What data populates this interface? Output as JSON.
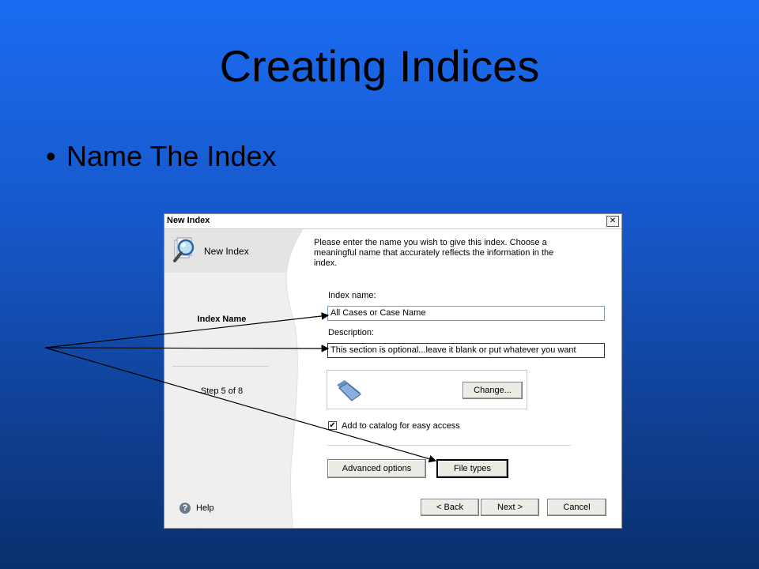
{
  "slide": {
    "title": "Creating Indices",
    "bullet": "Name The Index",
    "bullet_char": "•"
  },
  "dialog": {
    "title": "New Index",
    "close_glyph": "✕",
    "heading": "New Index",
    "step_name": "Index Name",
    "step_count": "Step 5 of 8",
    "help_label": "Help",
    "help_glyph": "?",
    "intro": "Please enter the name you wish to give this index. Choose a meaningful name that accurately reflects the information in the index.",
    "index_name_label": "Index name:",
    "index_name_value": "All Cases or Case Name",
    "description_label": "Description:",
    "description_value": "This section is optional...leave it blank or put whatever you want",
    "change_button": "Change...",
    "catalog_checkbox_label": "Add to catalog for easy access",
    "catalog_checked": true,
    "check_glyph": "✔",
    "advanced_button": "Advanced options",
    "file_types_button": "File types",
    "back_button": "< Back",
    "next_button": "Next >",
    "cancel_button": "Cancel"
  },
  "icons": {
    "wizard": "magnifier-icon",
    "folder": "folder-icon",
    "help": "help-icon",
    "close": "close-icon"
  },
  "colors": {
    "slide_bg_top": "#1b6cf2",
    "slide_bg_bottom": "#0b2f6e",
    "panel_bg": "#efefee"
  }
}
